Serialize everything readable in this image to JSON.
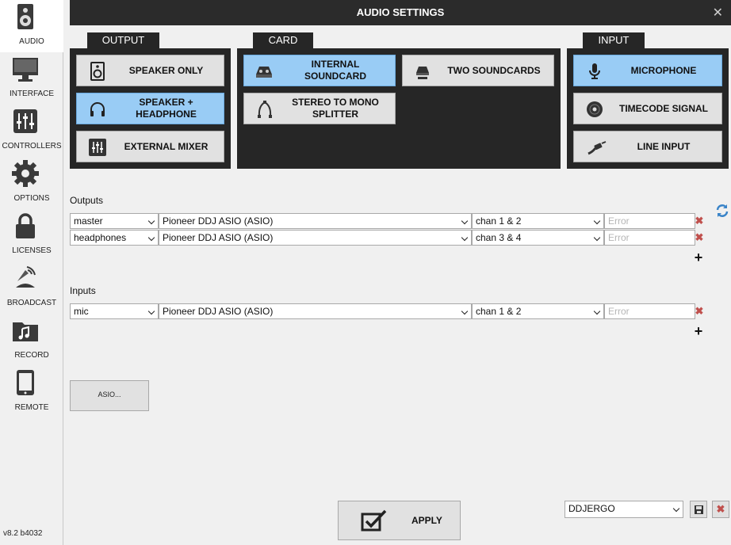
{
  "sidebar": {
    "items": [
      {
        "label": "AUDIO",
        "icon": "speaker-icon"
      },
      {
        "label": "INTERFACE",
        "icon": "monitor-icon"
      },
      {
        "label": "CONTROLLERS",
        "icon": "sliders-icon"
      },
      {
        "label": "OPTIONS",
        "icon": "gear-icon"
      },
      {
        "label": "LICENSES",
        "icon": "lock-icon"
      },
      {
        "label": "BROADCAST",
        "icon": "antenna-icon"
      },
      {
        "label": "RECORD",
        "icon": "music-folder-icon"
      },
      {
        "label": "REMOTE",
        "icon": "tablet-icon"
      }
    ],
    "version": "v8.2 b4032"
  },
  "window": {
    "title": "AUDIO SETTINGS",
    "close": "✕"
  },
  "output": {
    "tab": "OUTPUT",
    "options": [
      {
        "label": "SPEAKER ONLY",
        "selected": false
      },
      {
        "label": "SPEAKER + HEADPHONE",
        "selected": true
      },
      {
        "label": "EXTERNAL MIXER",
        "selected": false
      }
    ]
  },
  "card": {
    "tab": "CARD",
    "options": [
      {
        "label": "INTERNAL SOUNDCARD",
        "selected": true
      },
      {
        "label": "TWO SOUNDCARDS",
        "selected": false
      },
      {
        "label": "STEREO TO MONO SPLITTER",
        "selected": false
      }
    ]
  },
  "input": {
    "tab": "INPUT",
    "options": [
      {
        "label": "MICROPHONE",
        "selected": true
      },
      {
        "label": "TIMECODE SIGNAL",
        "selected": false
      },
      {
        "label": "LINE INPUT",
        "selected": false
      }
    ]
  },
  "outputs": {
    "label": "Outputs",
    "rows": [
      {
        "name": "master",
        "device": "Pioneer DDJ ASIO (ASIO)",
        "channels": "chan 1 & 2",
        "status_placeholder": "Error"
      },
      {
        "name": "headphones",
        "device": "Pioneer DDJ ASIO (ASIO)",
        "channels": "chan 3 & 4",
        "status_placeholder": "Error"
      }
    ]
  },
  "inputs": {
    "label": "Inputs",
    "rows": [
      {
        "name": "mic",
        "device": "Pioneer DDJ ASIO (ASIO)",
        "channels": "chan 1 & 2",
        "status_placeholder": "Error"
      }
    ]
  },
  "asio_button": {
    "label": "ASIO..."
  },
  "apply_button": {
    "label": "APPLY"
  },
  "preset": {
    "value": "DDJERGO"
  },
  "colors": {
    "selected": "#99ccf5",
    "panel": "#262626",
    "delete": "#c0504d",
    "titlebar": "#2b2b2b"
  }
}
